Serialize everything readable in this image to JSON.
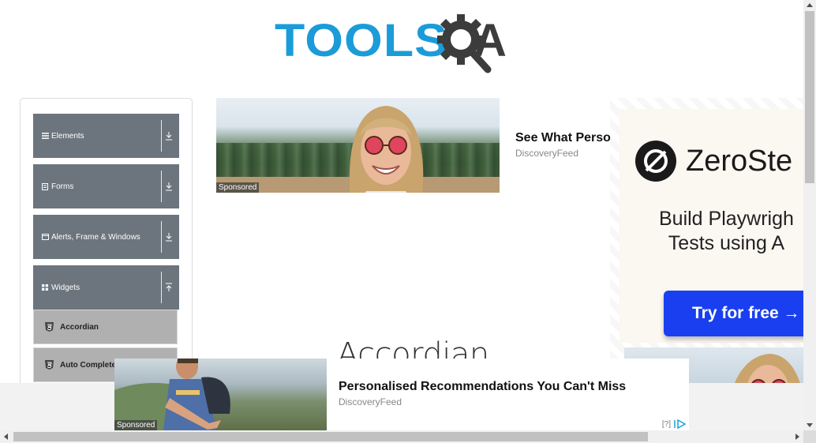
{
  "logo": {
    "part1": "TOOLS",
    "part2": "A"
  },
  "sidebar": {
    "groups": [
      {
        "label": "Elements",
        "icon": "hamburger-icon"
      },
      {
        "label": "Forms",
        "icon": "document-icon"
      },
      {
        "label": "Alerts, Frame & Windows",
        "icon": "window-icon"
      },
      {
        "label": "Widgets",
        "icon": "grid-icon"
      }
    ],
    "items": [
      {
        "label": "Accordian",
        "icon": "html5-icon"
      },
      {
        "label": "Auto Complete",
        "icon": "html5-icon"
      }
    ]
  },
  "top_ad": {
    "sponsored": "Sponsored",
    "title": "See What Perso",
    "source": "DiscoveryFeed"
  },
  "right_ad": {
    "brand": "ZeroSte",
    "tagline_line1": "Build Playwrigh",
    "tagline_line2": "Tests using A",
    "cta": "Try for free →"
  },
  "main": {
    "heading": "Accordian"
  },
  "bottom_ad": {
    "sponsored": "Sponsored",
    "title": "Personalised Recommendations You Can't Miss",
    "source": "DiscoveryFeed",
    "adchoice": "[?]"
  },
  "colors": {
    "brand_blue": "#1b9cd8",
    "sidebar_header": "#6c757d",
    "sidebar_item_active": "#b0b0b0",
    "cta_blue": "#1a3ff0"
  }
}
